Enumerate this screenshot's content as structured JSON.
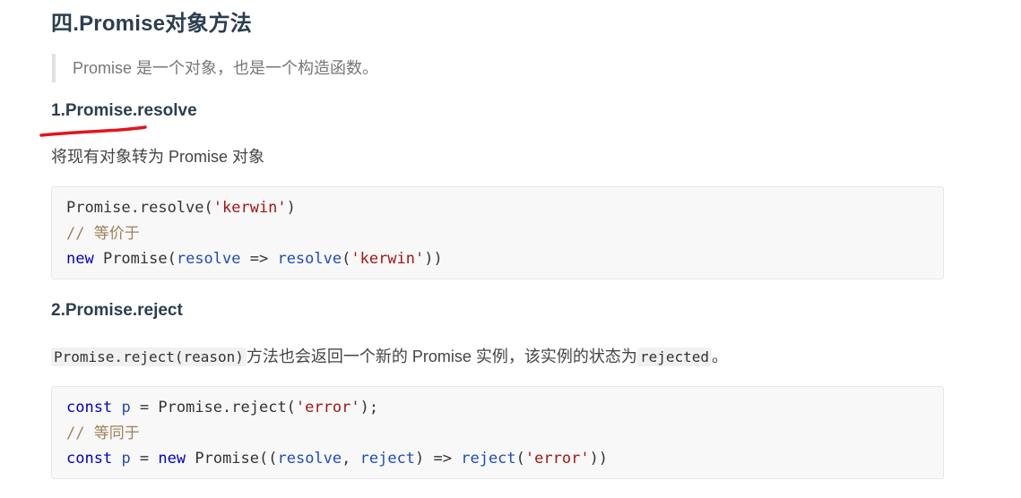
{
  "heading": "四.Promise对象方法",
  "quote": "Promise 是一个对象，也是一个构造函数。",
  "section1": {
    "title": "1.Promise.resolve",
    "desc": "将现有对象转为 Promise 对象",
    "code": {
      "l1_a": "Promise.resolve(",
      "l1_b": "'kerwin'",
      "l1_c": ")",
      "l2": "// 等价于",
      "l3_a": "new",
      "l3_b": " Promise(",
      "l3_c": "resolve",
      "l3_d": " => ",
      "l3_e": "resolve",
      "l3_f": "(",
      "l3_g": "'kerwin'",
      "l3_h": "))"
    }
  },
  "section2": {
    "title": "2.Promise.reject",
    "desc_code1": "Promise.reject(reason)",
    "desc_text": "方法也会返回一个新的 Promise 实例，该实例的状态为",
    "desc_code2": "rejected",
    "desc_end": "。",
    "code": {
      "l1_a": "const",
      "l1_b": " ",
      "l1_c": "p",
      "l1_d": " = Promise.reject(",
      "l1_e": "'error'",
      "l1_f": ");",
      "l2": "// 等同于",
      "l3_a": "const",
      "l3_b": " ",
      "l3_c": "p",
      "l3_d": " = ",
      "l3_e": "new",
      "l3_f": " Promise((",
      "l3_g": "resolve",
      "l3_h": ", ",
      "l3_i": "reject",
      "l3_j": ") => ",
      "l3_k": "reject",
      "l3_l": "(",
      "l3_m": "'error'",
      "l3_n": "))"
    }
  },
  "colors": {
    "underline_mark": "#e0161d",
    "keyword": "#0000c8",
    "string": "#a31515",
    "comment": "#a0805a"
  }
}
